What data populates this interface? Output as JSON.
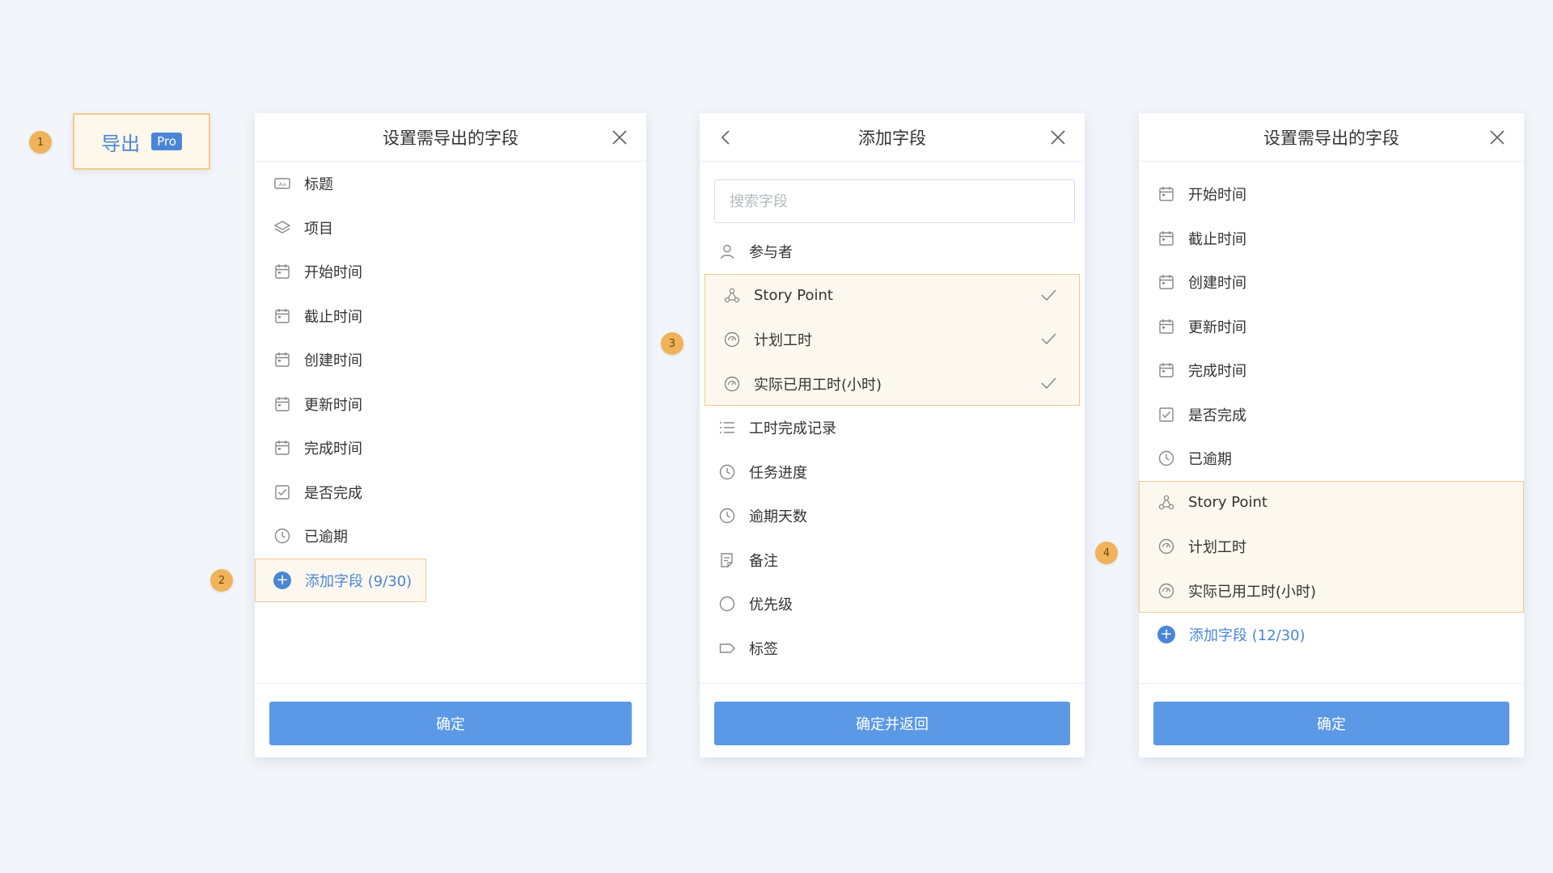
{
  "export_button": {
    "label": "导出",
    "badge": "Pro"
  },
  "steps": [
    "1",
    "2",
    "3",
    "4"
  ],
  "panel1": {
    "title": "设置需导出的字段",
    "fields": [
      {
        "label": "标题",
        "icon": "text-field-icon"
      },
      {
        "label": "项目",
        "icon": "layers-icon"
      },
      {
        "label": "开始时间",
        "icon": "calendar-icon"
      },
      {
        "label": "截止时间",
        "icon": "calendar-icon"
      },
      {
        "label": "创建时间",
        "icon": "calendar-icon"
      },
      {
        "label": "更新时间",
        "icon": "calendar-icon"
      },
      {
        "label": "完成时间",
        "icon": "calendar-icon"
      },
      {
        "label": "是否完成",
        "icon": "checkbox-icon"
      },
      {
        "label": "已逾期",
        "icon": "clock-icon"
      }
    ],
    "add_field": "添加字段 (9/30)",
    "confirm": "确定"
  },
  "panel2": {
    "title": "添加字段",
    "search_placeholder": "搜索字段",
    "fields": [
      {
        "label": "参与者",
        "icon": "user-icon",
        "selected": false
      },
      {
        "label": "Story Point",
        "icon": "story-point-icon",
        "selected": true
      },
      {
        "label": "计划工时",
        "icon": "gauge-icon",
        "selected": true
      },
      {
        "label": "实际已用工时(小时)",
        "icon": "gauge-icon",
        "selected": true
      },
      {
        "label": "工时完成记录",
        "icon": "list-icon",
        "selected": false
      },
      {
        "label": "任务进度",
        "icon": "clock-icon",
        "selected": false
      },
      {
        "label": "逾期天数",
        "icon": "clock-icon",
        "selected": false
      },
      {
        "label": "备注",
        "icon": "note-icon",
        "selected": false
      },
      {
        "label": "优先级",
        "icon": "circle-icon",
        "selected": false
      },
      {
        "label": "标签",
        "icon": "tag-icon",
        "selected": false
      }
    ],
    "confirm": "确定并返回"
  },
  "panel3": {
    "title": "设置需导出的字段",
    "fields": [
      {
        "label": "开始时间",
        "icon": "calendar-icon"
      },
      {
        "label": "截止时间",
        "icon": "calendar-icon"
      },
      {
        "label": "创建时间",
        "icon": "calendar-icon"
      },
      {
        "label": "更新时间",
        "icon": "calendar-icon"
      },
      {
        "label": "完成时间",
        "icon": "calendar-icon"
      },
      {
        "label": "是否完成",
        "icon": "checkbox-icon"
      },
      {
        "label": "已逾期",
        "icon": "clock-icon"
      },
      {
        "label": "Story Point",
        "icon": "story-point-icon"
      },
      {
        "label": "计划工时",
        "icon": "gauge-icon"
      },
      {
        "label": "实际已用工时(小时)",
        "icon": "gauge-icon"
      }
    ],
    "add_field": "添加字段 (12/30)",
    "confirm": "确定"
  },
  "colors": {
    "accent": "#5b98e6",
    "link": "#4a86d6",
    "highlight_bg": "#fdf8ef",
    "highlight_border": "#f3c98b",
    "step_badge": "#f0b35a"
  }
}
